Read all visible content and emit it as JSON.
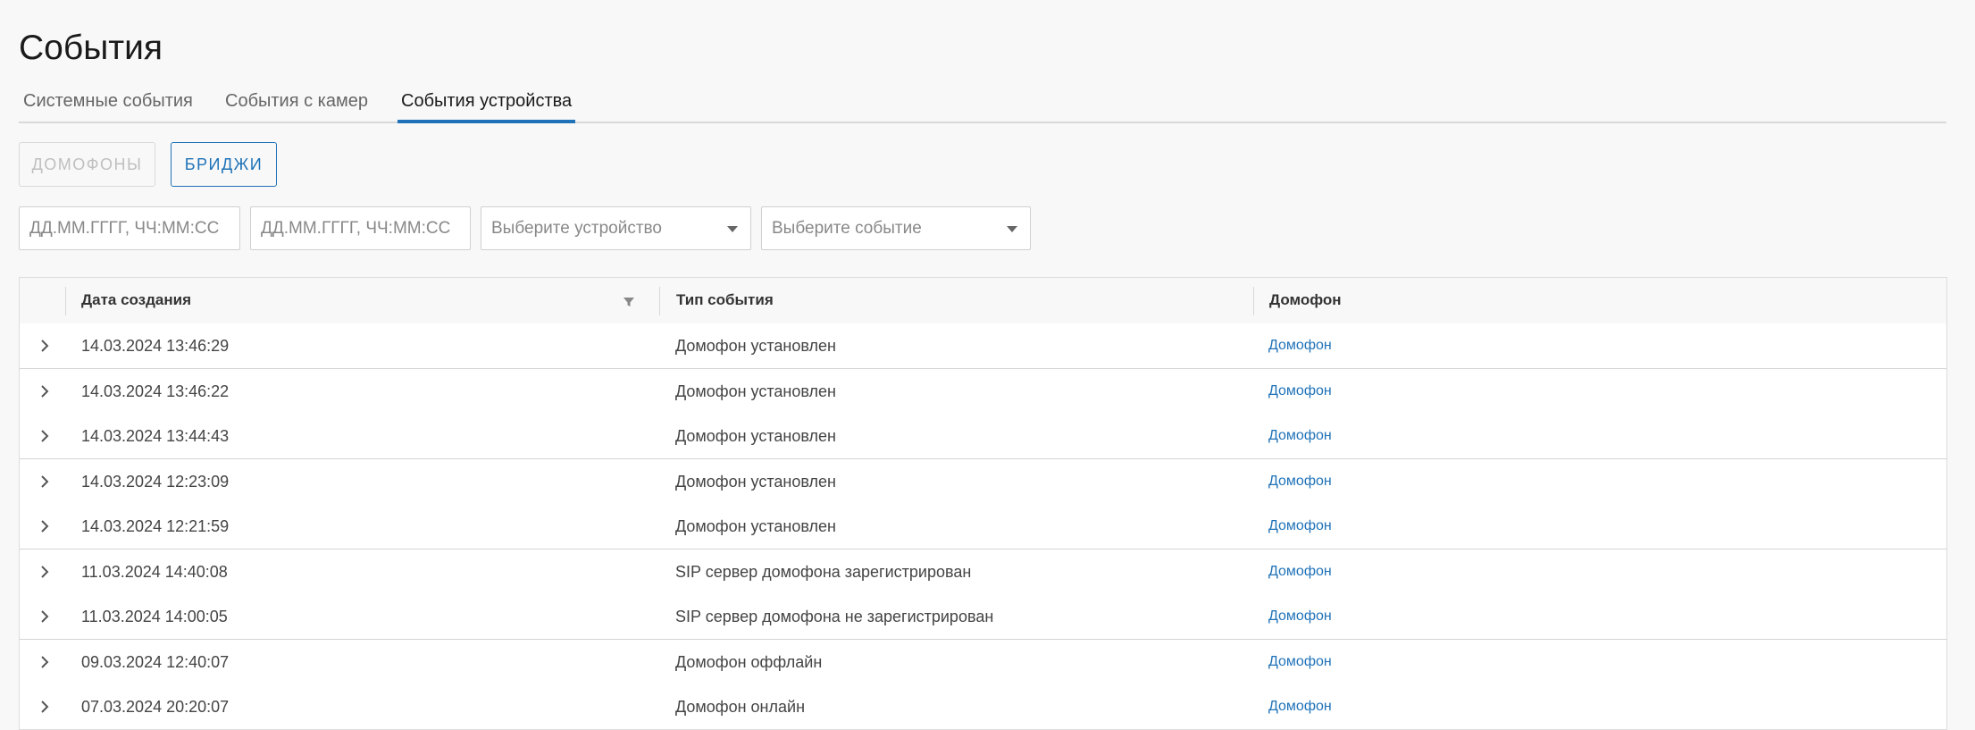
{
  "page": {
    "title": "События"
  },
  "tabs": [
    {
      "label": "Системные события",
      "active": false
    },
    {
      "label": "События с камер",
      "active": false
    },
    {
      "label": "События устройства",
      "active": true
    }
  ],
  "device_type_buttons": {
    "intercoms_label": "Домофоны",
    "intercoms_disabled": true,
    "bridges_label": "Бриджи"
  },
  "filters": {
    "date_from_placeholder": "ДД.ММ.ГГГГ, ЧЧ:ММ:СС",
    "date_to_placeholder": "ДД.ММ.ГГГГ, ЧЧ:ММ:СС",
    "device_placeholder": "Выберите устройство",
    "event_placeholder": "Выберите событие"
  },
  "table": {
    "columns": {
      "created": "Дата создания",
      "event_type": "Тип события",
      "intercom": "Домофон"
    },
    "rows": [
      {
        "date": "14.03.2024 13:46:29",
        "event": "Домофон установлен",
        "device": "Домофон"
      },
      {
        "date": "14.03.2024 13:46:22",
        "event": "Домофон установлен",
        "device": "Домофон"
      },
      {
        "date": "14.03.2024 13:44:43",
        "event": "Домофон установлен",
        "device": "Домофон"
      },
      {
        "date": "14.03.2024 12:23:09",
        "event": "Домофон установлен",
        "device": "Домофон"
      },
      {
        "date": "14.03.2024 12:21:59",
        "event": "Домофон установлен",
        "device": "Домофон"
      },
      {
        "date": "11.03.2024 14:40:08",
        "event": "SIP сервер домофона зарегистрирован",
        "device": "Домофон"
      },
      {
        "date": "11.03.2024 14:00:05",
        "event": "SIP сервер домофона не зарегистрирован",
        "device": "Домофон"
      },
      {
        "date": "09.03.2024 12:40:07",
        "event": "Домофон оффлайн",
        "device": "Домофон"
      },
      {
        "date": "07.03.2024 20:20:07",
        "event": "Домофон онлайн",
        "device": "Домофон"
      }
    ]
  },
  "colors": {
    "accent": "#1f72b8",
    "background": "#f8f8f8"
  },
  "icons": {
    "row_expand": "chevron-right-icon",
    "column_filter": "filter-icon",
    "select_caret": "caret-down-icon"
  }
}
